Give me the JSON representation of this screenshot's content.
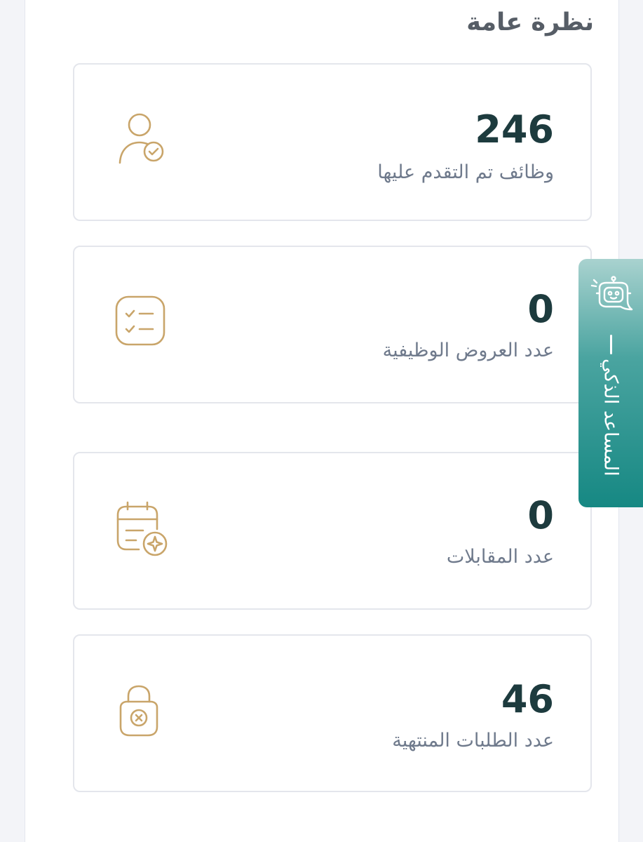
{
  "section": {
    "title": "نظرة عامة"
  },
  "stats": [
    {
      "value": "246",
      "label": "وظائف تم التقدم عليها",
      "icon": "user-check-icon"
    },
    {
      "value": "0",
      "label": "عدد العروض الوظيفية",
      "icon": "checklist-icon"
    },
    {
      "value": "0",
      "label": "عدد المقابلات",
      "icon": "calendar-star-icon"
    },
    {
      "value": "46",
      "label": "عدد الطلبات المنتهية",
      "icon": "closed-lock-icon"
    }
  ],
  "assistant": {
    "label": "المساعد الذكي",
    "icon": "robot-chat-icon"
  },
  "colors": {
    "accent_gold": "#c9a56a",
    "value_dark": "#1d3b3e",
    "label_gray": "#6f7a8c",
    "assistant_teal": "#168883"
  }
}
